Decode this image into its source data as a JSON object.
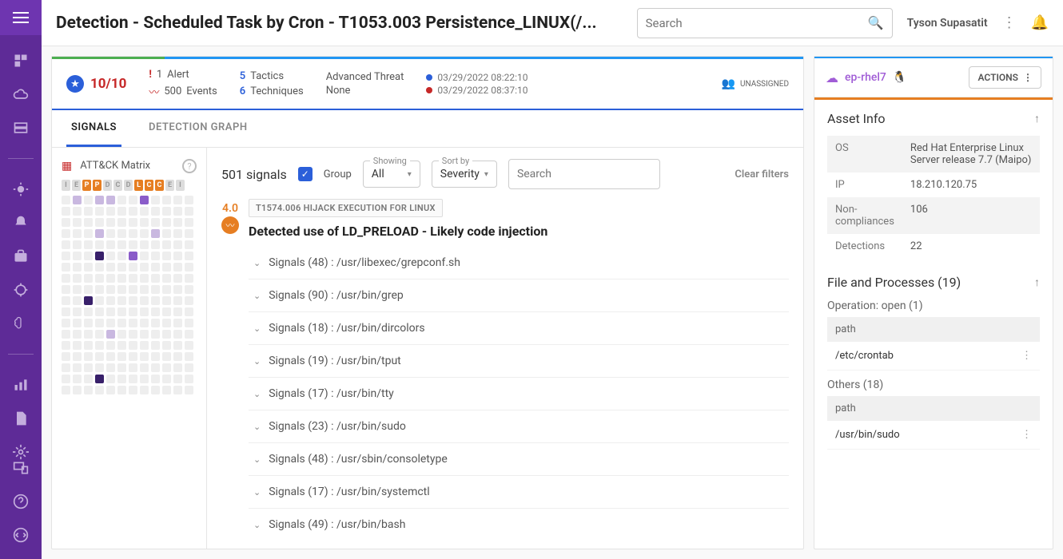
{
  "header": {
    "title": "Detection - Scheduled Task by Cron - T1053.003 Persistence_LINUX(/...",
    "search_placeholder": "Search",
    "user": "Tyson Supasatit"
  },
  "summary": {
    "score": "10/10",
    "alerts_count": "1",
    "alerts_label": "Alert",
    "events_count": "500",
    "events_label": "Events",
    "tactics_count": "5",
    "tactics_label": "Tactics",
    "techniques_count": "6",
    "techniques_label": "Techniques",
    "advanced_label": "Advanced Threat",
    "advanced_value": "None",
    "time_start": "03/29/2022 08:22:10",
    "time_end": "03/29/2022 08:37:10",
    "assignee": "UNASSIGNED"
  },
  "tabs": {
    "signals": "SIGNALS",
    "graph": "DETECTION GRAPH"
  },
  "matrix": {
    "title": "ATT&CK Matrix",
    "letters": [
      "I",
      "E",
      "P",
      "P",
      "D",
      "C",
      "D",
      "L",
      "C",
      "C",
      "E",
      "I"
    ],
    "letter_colors": [
      0,
      0,
      1,
      1,
      0,
      0,
      0,
      1,
      1,
      1,
      0,
      0
    ]
  },
  "signals": {
    "count": "501 signals",
    "group_label": "Group",
    "showing_label": "Showing",
    "showing_value": "All",
    "sort_label": "Sort by",
    "sort_value": "Severity",
    "search_placeholder": "Search",
    "clear": "Clear filters",
    "detection": {
      "score": "4.0",
      "tag": "T1574.006 HIJACK EXECUTION FOR LINUX",
      "title": "Detected use of LD_PRELOAD - Likely code injection",
      "items": [
        "Signals (48) : /usr/libexec/grepconf.sh",
        "Signals (90) : /usr/bin/grep",
        "Signals (18) : /usr/bin/dircolors",
        "Signals (19) : /usr/bin/tput",
        "Signals (17) : /usr/bin/tty",
        "Signals (23) : /usr/bin/sudo",
        "Signals (48) : /usr/sbin/consoletype",
        "Signals (17) : /usr/bin/systemctl",
        "Signals (49) : /usr/bin/bash"
      ]
    }
  },
  "asset": {
    "name": "ep-rhel7",
    "actions": "ACTIONS",
    "info_title": "Asset Info",
    "rows": [
      {
        "k": "OS",
        "v": "Red Hat Enterprise Linux Server release 7.7 (Maipo)"
      },
      {
        "k": "IP",
        "v": "18.210.120.75"
      },
      {
        "k": "Non-compliances",
        "v": "106"
      },
      {
        "k": "Detections",
        "v": "22"
      }
    ],
    "files_title": "File and Processes (19)",
    "op_open": "Operation: open (1)",
    "path_label": "path",
    "open_path": "/etc/crontab",
    "others": "Others (18)",
    "others_path": "/usr/bin/sudo"
  }
}
